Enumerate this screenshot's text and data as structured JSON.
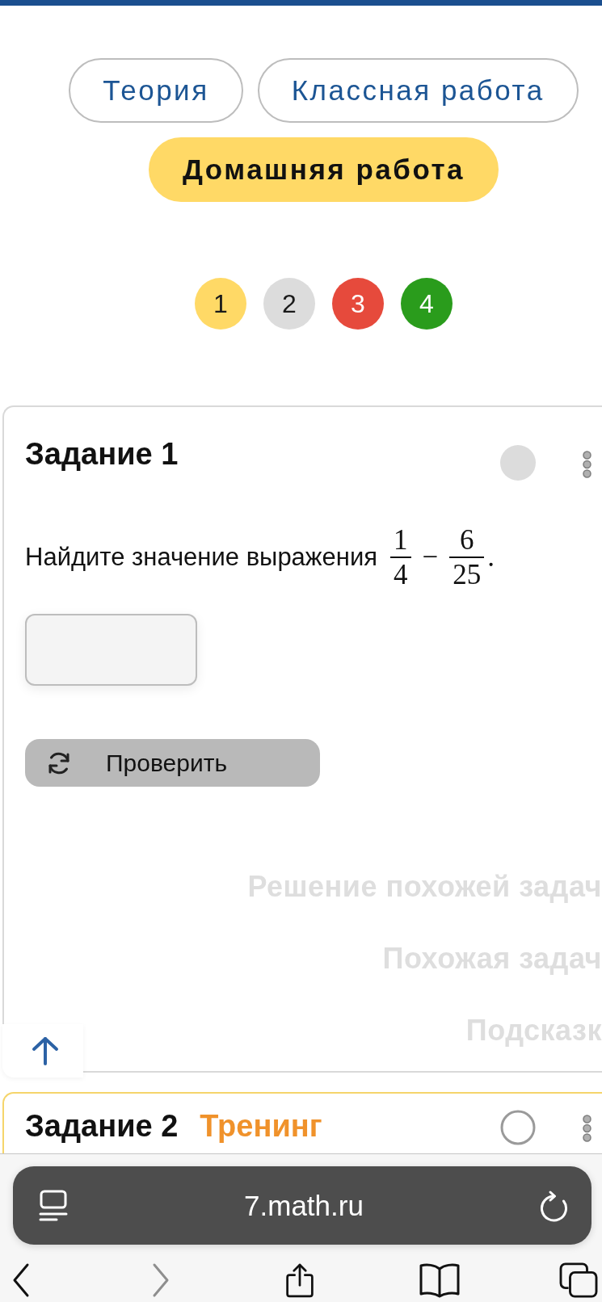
{
  "tabs": [
    {
      "label": "Теория",
      "selected": false
    },
    {
      "label": "Классная работа",
      "selected": false
    },
    {
      "label": "Домашняя работа",
      "selected": true
    }
  ],
  "task_nav": [
    {
      "label": "1",
      "color": "#ffd966"
    },
    {
      "label": "2",
      "color": "#dcdcdc"
    },
    {
      "label": "3",
      "color": "#e64a3c"
    },
    {
      "label": "4",
      "color": "#2a9c1c"
    }
  ],
  "tasks": [
    {
      "kind": "basic",
      "title": "Задание 1",
      "prompt": "Найдите значение выражения",
      "expression": [
        {
          "kind": "fraction",
          "numerator": "1",
          "denominator": "4"
        },
        {
          "kind": "operator",
          "text": "−"
        },
        {
          "kind": "fraction",
          "numerator": "6",
          "denominator": "25"
        },
        {
          "kind": "punctuation",
          "text": "."
        }
      ],
      "check_button": "Проверить",
      "help_links": [
        "Решение похожей задач",
        "Похожая задач",
        "Подсказк"
      ]
    },
    {
      "kind": "training",
      "title": "Задание 2",
      "tag": "Тренинг"
    }
  ],
  "browser": {
    "url": "7.math.ru",
    "toolbar": [
      {
        "kind": "back",
        "disabled": false
      },
      {
        "kind": "forward",
        "disabled": true
      },
      {
        "kind": "share",
        "disabled": false
      },
      {
        "kind": "bookmarks",
        "disabled": false
      },
      {
        "kind": "tabs",
        "disabled": false
      }
    ]
  }
}
